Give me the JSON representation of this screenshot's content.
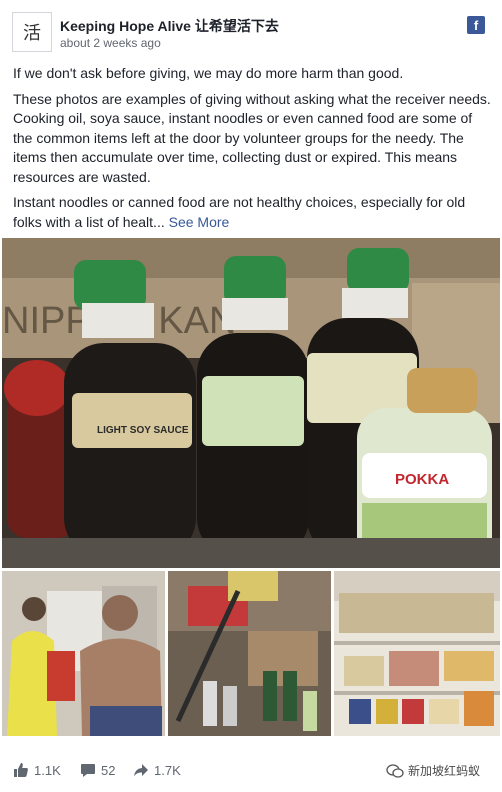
{
  "post": {
    "avatar_text": "活",
    "page_name": "Keeping Hope Alive 让希望活下去",
    "timestamp": "about 2 weeks ago",
    "paragraphs": [
      "If we don't ask before giving, we may do more harm than good.",
      "These photos are examples of giving without asking what the receiver needs. Cooking oil, soya sauce, instant noodles or even canned food are some of the common items left at the door by volunteer groups for the needy. The items then accumulate over time, collecting dust or expired. This means resources are wasted.",
      "Instant noodles or canned food are not healthy choices, especially for old folks with a list of healt..."
    ],
    "see_more": "See More",
    "badge_text": "f"
  },
  "photo_text": {
    "box_text": "NIPPON KAN",
    "bottle_1_label": "LIGHT SOY SAUCE",
    "bottle_4_label": "POKKA"
  },
  "footer": {
    "likes": "1.1K",
    "comments": "52",
    "shares": "1.7K",
    "watermark": "新加坡红蚂蚁"
  }
}
